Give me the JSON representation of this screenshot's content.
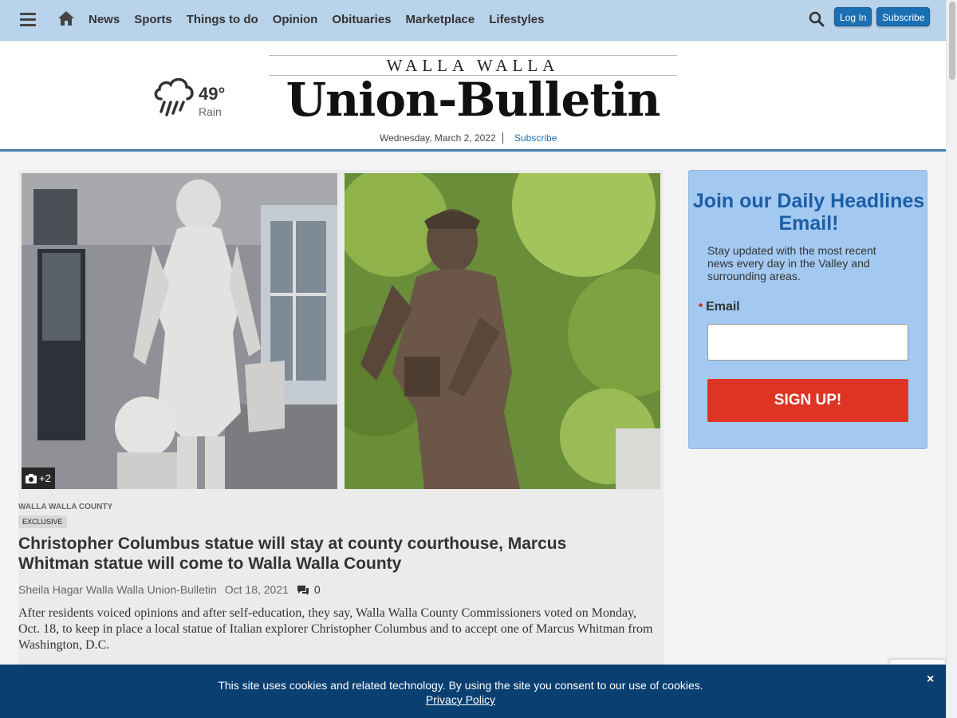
{
  "nav": {
    "items": [
      "News",
      "Sports",
      "Things to do",
      "Opinion",
      "Obituaries",
      "Marketplace",
      "Lifestyles"
    ],
    "login_label": "Log In",
    "subscribe_label": "Subscribe"
  },
  "masthead": {
    "weather": {
      "temp": "49°",
      "condition": "Rain"
    },
    "logo_pre": "WALLA WALLA",
    "logo_main": "Union-Bulletin",
    "date": "Wednesday, March 2, 2022",
    "subscribe_link": "Subscribe"
  },
  "story": {
    "photo_count": "+2",
    "kicker": "Walla Walla County",
    "badge": "EXCLUSIVE",
    "headline": "Christopher Columbus statue will stay at county courthouse, Marcus Whitman statue will come to Walla Walla County",
    "author": "Sheila Hagar Walla Walla Union-Bulletin",
    "date": "Oct 18, 2021",
    "comment_count": "0",
    "summary": "After residents voiced opinions and after self-education, they say, Walla Walla County Commissioners voted on Monday, Oct. 18, to keep in place a local statue of Italian explorer Christopher Columbus and to accept one of Marcus Whitman from Washington, D.C."
  },
  "signup": {
    "title": "Join our Daily Headlines Email!",
    "description": "Stay updated with the most recent news every day in the Valley and surrounding areas.",
    "email_label": "Email",
    "required_mark": "*",
    "button_label": "SIGN UP!"
  },
  "cookie": {
    "message": "This site uses cookies and related technology. By using the site you consent to our use of cookies.",
    "policy_link": "Privacy Policy",
    "close": "×"
  },
  "colors": {
    "nav_bg": "#b9d3ea",
    "button_blue": "#1b6fb3",
    "signup_bg": "#a3c9f1",
    "signup_title": "#1b5ea6",
    "signup_button": "#de3423",
    "cookie_bg": "#0a3f72"
  },
  "icons": [
    "menu-icon",
    "home-icon",
    "search-icon",
    "rain-cloud-icon",
    "camera-icon",
    "comments-icon",
    "close-icon"
  ]
}
